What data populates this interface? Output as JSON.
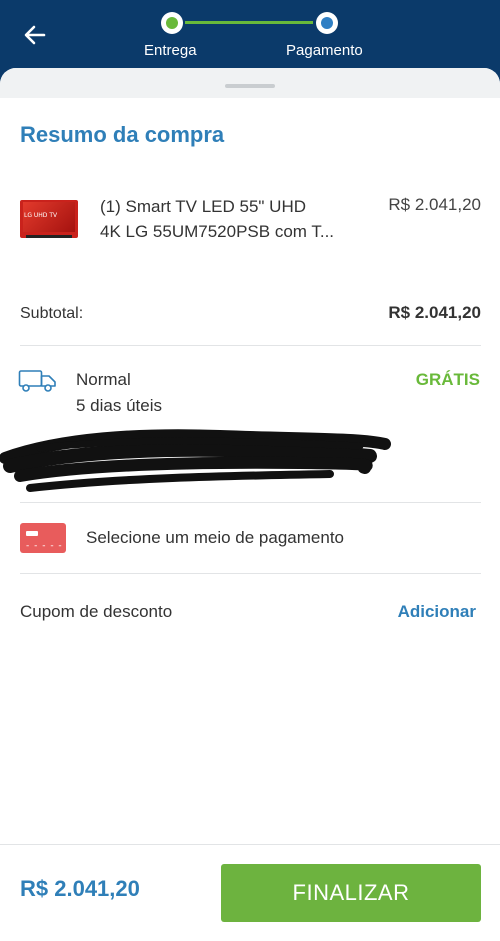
{
  "header": {
    "steps": [
      {
        "label": "Entrega",
        "status": "done",
        "color": "#69b93a"
      },
      {
        "label": "Pagamento",
        "status": "current",
        "color": "#2f7fc4"
      }
    ]
  },
  "summary": {
    "title": "Resumo da compra",
    "product": {
      "quantity_name_line1": "(1) Smart TV LED 55\" UHD",
      "quantity_name_line2": "4K LG 55UM7520PSB com T...",
      "price": "R$ 2.041,20",
      "thumbnail_text": "LG UHD TV"
    },
    "subtotal_label": "Subtotal:",
    "subtotal_value": "R$ 2.041,20"
  },
  "shipping": {
    "type": "Normal",
    "time": "5 dias úteis",
    "price": "GRÁTIS"
  },
  "payment": {
    "label": "Selecione um meio de pagamento"
  },
  "coupon": {
    "label": "Cupom de desconto",
    "action": "Adicionar"
  },
  "footer": {
    "total": "R$ 2.041,20",
    "button": "FINALIZAR"
  },
  "colors": {
    "header_bg": "#0b3a6a",
    "accent_blue": "#2f7fb8",
    "success_green": "#69b93a",
    "button_green": "#6db33f",
    "card_red": "#e85c5c"
  }
}
